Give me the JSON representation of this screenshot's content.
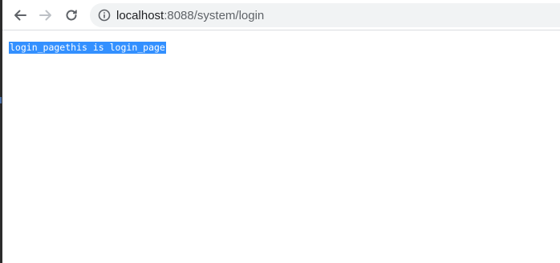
{
  "browser": {
    "url_host": "localhost",
    "url_path": ":8088/system/login",
    "icons": {
      "back": "back-arrow-icon",
      "forward": "forward-arrow-icon",
      "reload": "reload-icon",
      "site_info": "info-icon"
    }
  },
  "page": {
    "body_text": "login_pagethis is login_page",
    "selection_color": "#3390ff"
  }
}
